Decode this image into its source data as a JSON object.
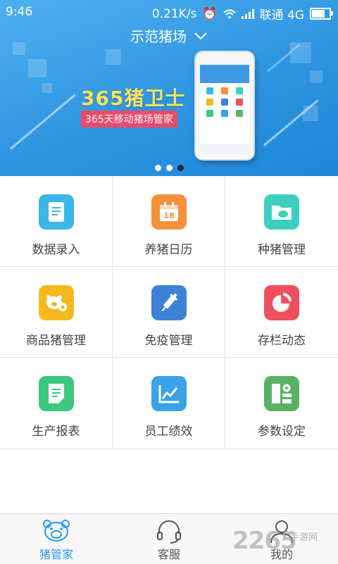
{
  "status_bar": {
    "time": "9:46",
    "speed": "0.21K/s",
    "carrier": "联通 4G",
    "battery_percent": 80
  },
  "header": {
    "farm_name": "示范猪场"
  },
  "banner": {
    "brand": "365猪卫士",
    "tagline": "365天移动猪场管家",
    "slide_count": 3,
    "active_slide": 3
  },
  "menu": [
    {
      "label": "数据录入",
      "icon": "document-icon",
      "color": "#3ab6e8"
    },
    {
      "label": "养猪日历",
      "icon": "calendar-icon",
      "color": "#f4913b",
      "badge": "18"
    },
    {
      "label": "种猪管理",
      "icon": "folder-pig-icon",
      "color": "#3ccfc0"
    },
    {
      "label": "商品猪管理",
      "icon": "pig-gear-icon",
      "color": "#f4b91f"
    },
    {
      "label": "免疫管理",
      "icon": "syringe-icon",
      "color": "#3c82d6"
    },
    {
      "label": "存栏动态",
      "icon": "pie-chart-icon",
      "color": "#f0505e"
    },
    {
      "label": "生产报表",
      "icon": "report-icon",
      "color": "#3cc77f"
    },
    {
      "label": "员工绩效",
      "icon": "trend-chart-icon",
      "color": "#3aa3e8"
    },
    {
      "label": "参数设定",
      "icon": "settings-grid-icon",
      "color": "#5ab265"
    }
  ],
  "tabs": [
    {
      "label": "猪管家",
      "icon": "pig-head-icon",
      "active": true
    },
    {
      "label": "客服",
      "icon": "headset-icon",
      "active": false
    },
    {
      "label": "我的",
      "icon": "person-icon",
      "active": false
    }
  ],
  "watermark": {
    "main": "2265",
    "sub": "手游网"
  }
}
